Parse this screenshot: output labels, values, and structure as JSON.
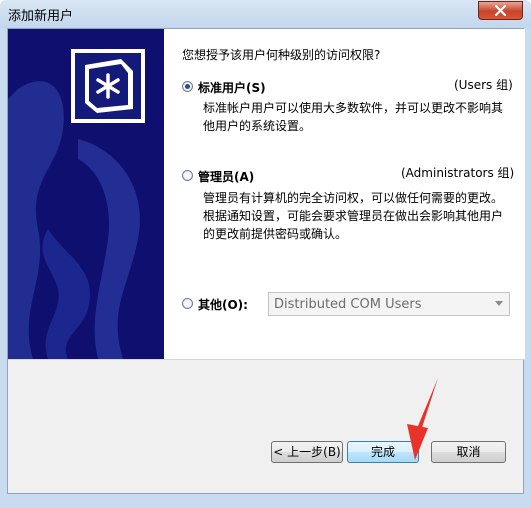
{
  "window": {
    "title": "添加新用户"
  },
  "dialog": {
    "question": "您想授予该用户何种级别的访问权限?",
    "options": [
      {
        "label": "标准用户(S)",
        "group": "(Users 组)",
        "description_lines": [
          "标准帐户用户可以使用大多数软件，并可以更改不影响其",
          "他用户的系统设置。"
        ],
        "selected": true
      },
      {
        "label": "管理员(A)",
        "group": "(Administrators 组)",
        "description_lines": [
          "管理员有计算机的完全访问权，可以做任何需要的更改。",
          "根据通知设置，可能会要求管理员在做出会影响其他用户",
          "的更改前提供密码或确认。"
        ],
        "selected": false
      },
      {
        "label": "其他(O):",
        "dropdown_value": "Distributed COM Users",
        "selected": false
      }
    ]
  },
  "buttons": {
    "back": "< 上一步(B)",
    "finish": "完成",
    "cancel": "取消"
  },
  "icons": {
    "close": "close-icon",
    "logo": "user-security-logo-icon",
    "dropdown": "chevron-down-icon"
  },
  "colors": {
    "banner": "#0e0f6e",
    "annotation_arrow": "#e8322a"
  }
}
